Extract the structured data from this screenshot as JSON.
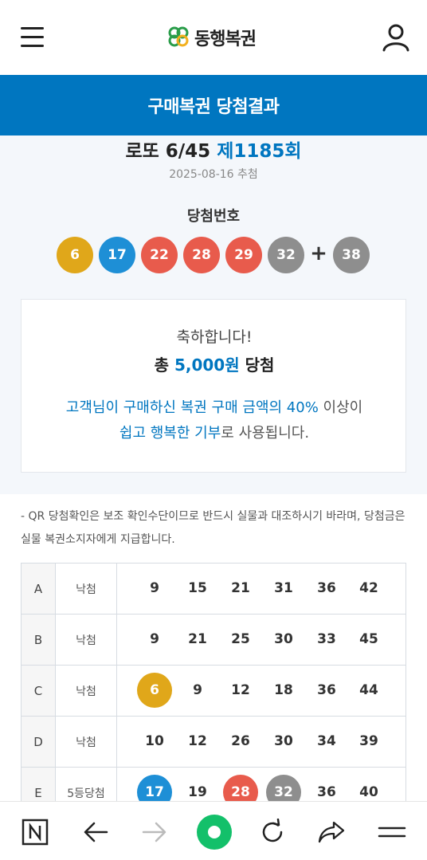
{
  "header": {
    "logo_text": "동행복권"
  },
  "page_title": "구매복권 당첨결과",
  "draw": {
    "game": "로또 6/45",
    "round": "제1185회",
    "date": "2025-08-16 추첨",
    "numbers_label": "당첨번호",
    "plus": "+"
  },
  "winning_numbers": [
    {
      "value": "6",
      "color": "#e0a71a"
    },
    {
      "value": "17",
      "color": "#1e8fd6"
    },
    {
      "value": "22",
      "color": "#e85b4c"
    },
    {
      "value": "28",
      "color": "#e85b4c"
    },
    {
      "value": "29",
      "color": "#e85b4c"
    },
    {
      "value": "32",
      "color": "#8e8e8e"
    }
  ],
  "bonus_number": {
    "value": "38",
    "color": "#8e8e8e"
  },
  "prize": {
    "congrats": "축하합니다!",
    "prefix": "총",
    "amount": "5,000원",
    "suffix": "당첨",
    "donate_hl1": "고객님이 구매하신 복권 구매 금액의 40%",
    "donate_rest1": " 이상이",
    "donate_hl2": "쉽고 행복한 기부",
    "donate_rest2": "로 사용됩니다."
  },
  "notice": "- QR 당첨확인은 보조 확인수단이므로 반드시 실물과 대조하시기 바라며, 당첨금은 실물 복권소지자에게 지급합니다.",
  "tickets": [
    {
      "id": "A",
      "result": "낙첨",
      "numbers": [
        {
          "v": "9",
          "hit": ""
        },
        {
          "v": "15",
          "hit": ""
        },
        {
          "v": "21",
          "hit": ""
        },
        {
          "v": "31",
          "hit": ""
        },
        {
          "v": "36",
          "hit": ""
        },
        {
          "v": "42",
          "hit": ""
        }
      ]
    },
    {
      "id": "B",
      "result": "낙첨",
      "numbers": [
        {
          "v": "9",
          "hit": ""
        },
        {
          "v": "21",
          "hit": ""
        },
        {
          "v": "25",
          "hit": ""
        },
        {
          "v": "30",
          "hit": ""
        },
        {
          "v": "33",
          "hit": ""
        },
        {
          "v": "45",
          "hit": ""
        }
      ]
    },
    {
      "id": "C",
      "result": "낙첨",
      "numbers": [
        {
          "v": "6",
          "hit": "#e0a71a"
        },
        {
          "v": "9",
          "hit": ""
        },
        {
          "v": "12",
          "hit": ""
        },
        {
          "v": "18",
          "hit": ""
        },
        {
          "v": "36",
          "hit": ""
        },
        {
          "v": "44",
          "hit": ""
        }
      ]
    },
    {
      "id": "D",
      "result": "낙첨",
      "numbers": [
        {
          "v": "10",
          "hit": ""
        },
        {
          "v": "12",
          "hit": ""
        },
        {
          "v": "26",
          "hit": ""
        },
        {
          "v": "30",
          "hit": ""
        },
        {
          "v": "34",
          "hit": ""
        },
        {
          "v": "39",
          "hit": ""
        }
      ]
    },
    {
      "id": "E",
      "result": "5등당첨",
      "numbers": [
        {
          "v": "17",
          "hit": "#1e8fd6"
        },
        {
          "v": "19",
          "hit": ""
        },
        {
          "v": "28",
          "hit": "#e85b4c"
        },
        {
          "v": "32",
          "hit": "#8e8e8e"
        },
        {
          "v": "36",
          "hit": ""
        },
        {
          "v": "40",
          "hit": ""
        }
      ]
    }
  ],
  "colors": {
    "brand_blue": "#0076c0",
    "reload_green": "#13c06a"
  },
  "bottom_nav": [
    "naver-home-icon",
    "back-arrow-icon",
    "forward-arrow-icon",
    "green-dot-icon",
    "reload-icon",
    "share-icon",
    "menu-icon"
  ]
}
